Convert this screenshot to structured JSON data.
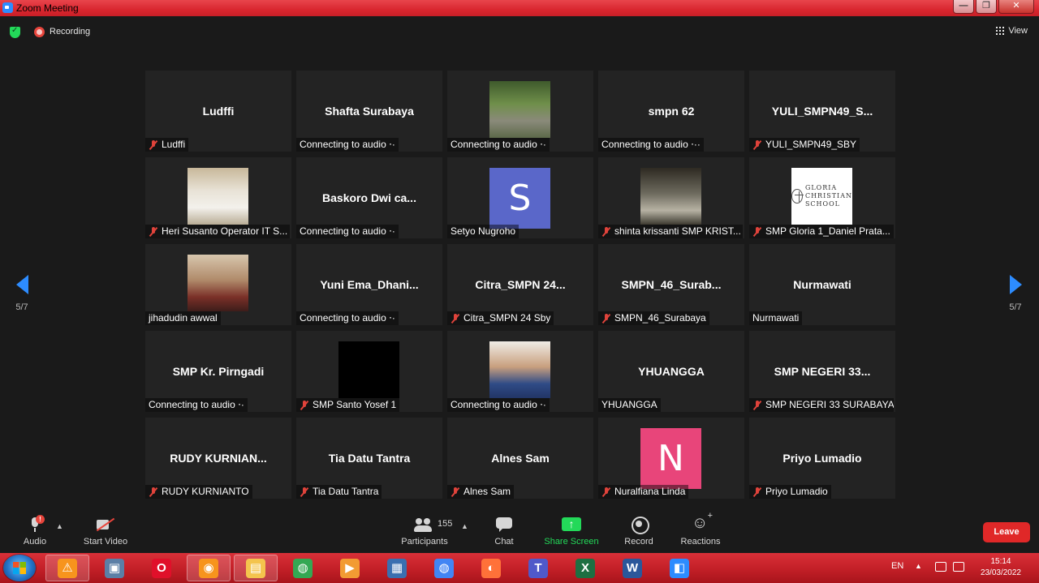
{
  "window": {
    "title": "Zoom Meeting",
    "controls": [
      "—",
      "❐",
      "✕"
    ]
  },
  "top_bar": {
    "recording_label": "Recording",
    "view_label": "View"
  },
  "pager": {
    "left_count": "5/7",
    "right_count": "5/7"
  },
  "tiles": [
    {
      "big": "Ludffi",
      "label": "Ludffi",
      "muted": true
    },
    {
      "big": "Shafta Surabaya",
      "label": "Connecting to audio ⋅·",
      "muted": false
    },
    {
      "photo": "graduation-photo",
      "label": "Connecting to audio ⋅·",
      "muted": false
    },
    {
      "big": "smpn 62",
      "label": "Connecting to audio ⋅··",
      "muted": false
    },
    {
      "big": "YULI_SMPN49_S...",
      "label": "YULI_SMPN49_SBY",
      "muted": true
    },
    {
      "photo": "wedding-photo",
      "label": "Heri Susanto Operator IT S...",
      "muted": true
    },
    {
      "big": "Baskoro  Dwi  ca...",
      "label": "Connecting to audio ⋅·",
      "muted": false
    },
    {
      "letter": "S",
      "letter_color": "#5a67c9",
      "label": "Setyo Nugroho",
      "muted": false
    },
    {
      "photo": "forest-photo",
      "label": "shinta krissanti SMP KRIST...",
      "muted": true
    },
    {
      "logo": [
        "GLORIA",
        "CHRISTIAN",
        "SCHOOL"
      ],
      "label": "SMP Gloria 1_Daniel Prata...",
      "muted": true
    },
    {
      "photo": "portrait-man-photo",
      "label": "jihadudin awwal",
      "muted": false
    },
    {
      "big": "Yuni  Ema_Dhani...",
      "label": "Connecting to audio ⋅·",
      "muted": false
    },
    {
      "big": "Citra_SMPN  24...",
      "label": "Citra_SMPN 24 Sby",
      "muted": true
    },
    {
      "big": "SMPN_46_Surab...",
      "label": "SMPN_46_Surabaya",
      "muted": true
    },
    {
      "big": "Nurmawati",
      "label": "Nurmawati",
      "muted": false
    },
    {
      "big": "SMP Kr. Pirngadi",
      "label": "Connecting to audio ⋅·",
      "muted": false
    },
    {
      "photo": "black-video",
      "label": "SMP Santo Yosef 1",
      "muted": true
    },
    {
      "photo": "portrait-woman-photo",
      "label": "Connecting to audio ⋅·",
      "muted": false
    },
    {
      "big": "YHUANGGA",
      "label": "YHUANGGA",
      "muted": false
    },
    {
      "big": "SMP NEGERI 33...",
      "label": "SMP NEGERI 33 SURABAYA",
      "muted": true
    },
    {
      "big": "RUDY  KURNIAN...",
      "label": "RUDY KURNIANTO",
      "muted": true
    },
    {
      "big": "Tia Datu Tantra",
      "label": "Tia Datu Tantra",
      "muted": true
    },
    {
      "big": "Alnes Sam",
      "label": "Alnes Sam",
      "muted": true
    },
    {
      "letter": "N",
      "letter_color": "#e8457a",
      "label": "Nuralfiana Linda",
      "muted": true
    },
    {
      "big": "Priyo Lumadio",
      "label": "Priyo Lumadio",
      "muted": true
    }
  ],
  "toolbar": {
    "audio_label": "Audio",
    "audio_badge": "!",
    "video_label": "Start Video",
    "participants_label": "Participants",
    "participants_count": "155",
    "chat_label": "Chat",
    "share_label": "Share Screen",
    "record_label": "Record",
    "reactions_label": "Reactions",
    "leave_label": "Leave",
    "share_color": "#23d959",
    "leave_color": "#e02828"
  },
  "taskbar": {
    "apps": [
      {
        "name": "avast",
        "color": "#f7941d",
        "glyph": "⚠"
      },
      {
        "name": "computer",
        "color": "#5b7fa6",
        "glyph": "▣"
      },
      {
        "name": "opera",
        "color": "#e0102a",
        "glyph": "O"
      },
      {
        "name": "avast-browser",
        "color": "#f7941d",
        "glyph": "◉"
      },
      {
        "name": "file-explorer",
        "color": "#f4c44d",
        "glyph": "▤"
      },
      {
        "name": "chrome-profile",
        "color": "#34a853",
        "glyph": "◍"
      },
      {
        "name": "media-player",
        "color": "#f29b33",
        "glyph": "▶"
      },
      {
        "name": "network-monitor",
        "color": "#3a6fb0",
        "glyph": "▦"
      },
      {
        "name": "chrome",
        "color": "#4285f4",
        "glyph": "◍"
      },
      {
        "name": "firefox",
        "color": "#ff7139",
        "glyph": "◐"
      },
      {
        "name": "teams",
        "color": "#5059c9",
        "glyph": "T"
      },
      {
        "name": "excel",
        "color": "#1d6f42",
        "glyph": "X"
      },
      {
        "name": "word",
        "color": "#2b579a",
        "glyph": "W"
      },
      {
        "name": "zoom",
        "color": "#2d8cff",
        "glyph": "◧"
      }
    ],
    "language": "EN",
    "time": "15:14",
    "date": "23/03/2022"
  }
}
